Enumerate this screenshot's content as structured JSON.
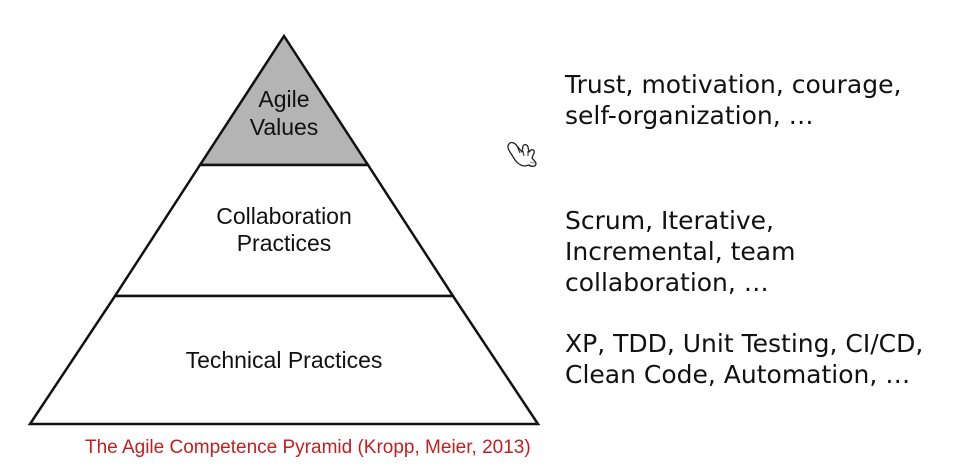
{
  "pyramid": {
    "top": {
      "lines": [
        "Agile",
        "Values"
      ],
      "fill": "#b4b4b4"
    },
    "middle": {
      "lines": [
        "Collaboration",
        "Practices"
      ],
      "fill": "#ffffff"
    },
    "bottom": {
      "lines": [
        "Technical Practices"
      ],
      "fill": "#ffffff"
    }
  },
  "descriptions": {
    "values": [
      "Trust, motivation, courage,",
      "self-organization, …"
    ],
    "collaboration": [
      "Scrum, Iterative,",
      "Incremental, team",
      "collaboration, …"
    ],
    "technical": [
      "XP, TDD, Unit Testing, CI/CD,",
      "Clean Code, Automation, …"
    ]
  },
  "caption": "The Agile Competence Pyramid (Kropp, Meier, 2013)",
  "colors": {
    "caption": "#c0201f",
    "outline": "#111111"
  },
  "cursor_icon": "pointer-hand-icon"
}
